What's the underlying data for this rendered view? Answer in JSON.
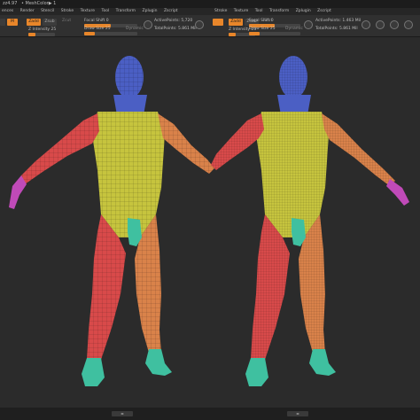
{
  "topbar": {
    "title": "zz4.97",
    "doc": "• MeshColor▶ 1"
  },
  "menu": {
    "left": [
      "ences",
      "Render",
      "Stencil",
      "Stroke",
      "Texture",
      "Tool",
      "Transform",
      "Zplugin",
      "Zscript"
    ],
    "right": [
      "Stroke",
      "Texture",
      "Tool",
      "Transform",
      "Zplugin",
      "Zscript"
    ]
  },
  "toolbar_left": {
    "rgb_label": "M",
    "zadd_label": "Zadd",
    "zsub_label": "Zsub",
    "zcut_label": "Zcut",
    "intensity_label": "Z Intensity 25",
    "focal_label": "Focal Shift 0",
    "draw_label": "Draw Size 25",
    "dynamic_label": "Dynamic",
    "active_points": "ActivePoints: 5,720",
    "total_points": "TotalPoints: 5.861 Mil"
  },
  "toolbar_right": {
    "zadd_label": "Zadd",
    "zsub_label": "Zsub",
    "zcut_label": "Zcut",
    "intensity_label": "Z Intensity 25",
    "focal_label": "Focal Shift 0",
    "draw_label": "Draw Size 25",
    "dynamic_label": "Dynamic",
    "active_points": "ActivePoints: 1.463 Mil",
    "total_points": "TotalPoints: 5.861 Mil"
  },
  "viewport": {
    "left_model": "Low poly base mesh, polygroups",
    "right_model": "Subdivided mesh, polygroups"
  },
  "colors": {
    "head": "#4b5fc4",
    "torso": "#c6c43e",
    "arm": "#d84a4a",
    "arm_right": "#d9824a",
    "leg_left": "#d84a4a",
    "leg_right": "#d9824a",
    "feet": "#3fc0a0",
    "hands": "#c04ab8",
    "accent": "#e8862a"
  },
  "bottom": {
    "tab_left": "◂▸",
    "tab_right": "◂▸"
  }
}
